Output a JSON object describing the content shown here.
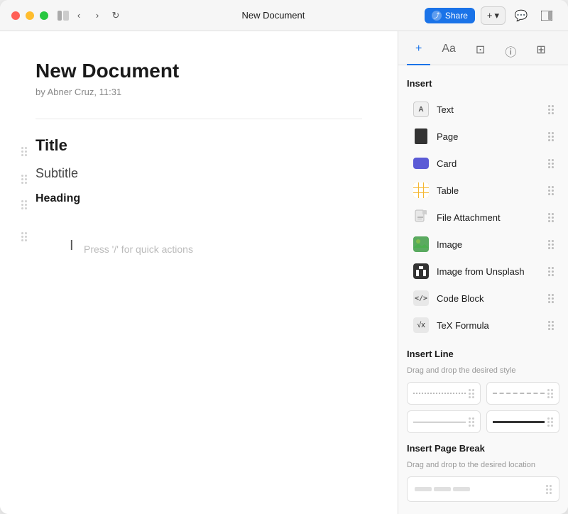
{
  "window": {
    "title": "New Document"
  },
  "titlebar": {
    "share_label": "Share",
    "plus_label": "+",
    "chevron_down": "▾"
  },
  "document": {
    "title": "New Document",
    "meta": "by Abner Cruz, 11:31",
    "elements": [
      {
        "type": "title",
        "text": "Title"
      },
      {
        "type": "subtitle",
        "text": "Subtitle"
      },
      {
        "type": "heading",
        "text": "Heading"
      }
    ],
    "placeholder": "Press '/' for quick actions"
  },
  "sidebar": {
    "tabs": [
      {
        "id": "insert",
        "icon": "+",
        "active": true
      },
      {
        "id": "format",
        "icon": "Aa",
        "active": false
      },
      {
        "id": "media",
        "icon": "⊡",
        "active": false
      },
      {
        "id": "info",
        "icon": "ⓘ",
        "active": false
      },
      {
        "id": "layout",
        "icon": "⊞",
        "active": false
      }
    ],
    "insert_section": {
      "label": "Insert",
      "items": [
        {
          "id": "text",
          "label": "Text",
          "icon_type": "text"
        },
        {
          "id": "page",
          "label": "Page",
          "icon_type": "page"
        },
        {
          "id": "card",
          "label": "Card",
          "icon_type": "card"
        },
        {
          "id": "table",
          "label": "Table",
          "icon_type": "table"
        },
        {
          "id": "file-attachment",
          "label": "File Attachment",
          "icon_type": "attachment"
        },
        {
          "id": "image",
          "label": "Image",
          "icon_type": "image"
        },
        {
          "id": "image-unsplash",
          "label": "Image from Unsplash",
          "icon_type": "unsplash"
        },
        {
          "id": "code-block",
          "label": "Code Block",
          "icon_type": "code"
        },
        {
          "id": "tex-formula",
          "label": "TeX Formula",
          "icon_type": "tex"
        }
      ]
    },
    "insert_line_section": {
      "label": "Insert Line",
      "sublabel": "Drag and drop the desired style",
      "lines": [
        {
          "id": "dotted",
          "type": "dotted"
        },
        {
          "id": "dashed",
          "type": "dashed"
        },
        {
          "id": "thin",
          "type": "thin"
        },
        {
          "id": "thick",
          "type": "thick"
        }
      ]
    },
    "insert_pagebreak_section": {
      "label": "Insert Page Break",
      "sublabel": "Drag and drop to the desired location"
    }
  }
}
